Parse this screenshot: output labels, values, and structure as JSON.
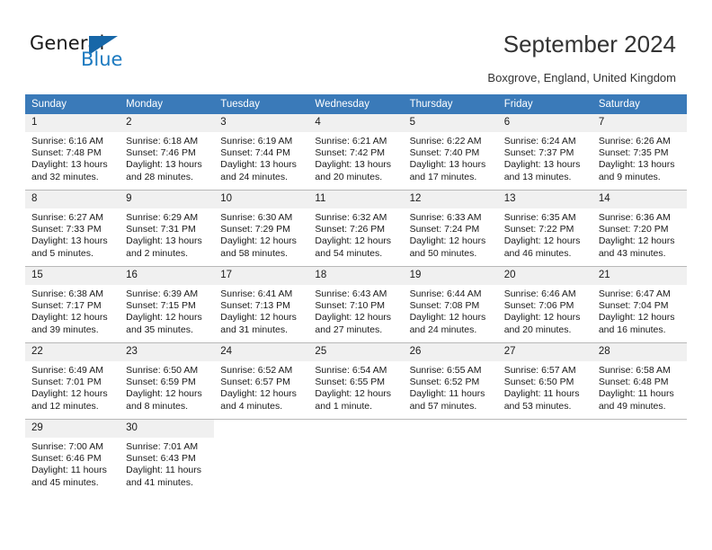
{
  "brand": {
    "name_part1": "General",
    "name_part2": "Blue"
  },
  "header": {
    "title": "September 2024",
    "location": "Boxgrove, England, United Kingdom"
  },
  "colors": {
    "header_bar": "#3a7ab9",
    "daynum_background": "#f0f0f0",
    "brand_blue": "#1c7ac0",
    "grid_line": "#b8b8b8"
  },
  "weekday_headers": [
    "Sunday",
    "Monday",
    "Tuesday",
    "Wednesday",
    "Thursday",
    "Friday",
    "Saturday"
  ],
  "weeks": [
    [
      {
        "day": "1",
        "sunrise": "Sunrise: 6:16 AM",
        "sunset": "Sunset: 7:48 PM",
        "daylight1": "Daylight: 13 hours",
        "daylight2": "and 32 minutes."
      },
      {
        "day": "2",
        "sunrise": "Sunrise: 6:18 AM",
        "sunset": "Sunset: 7:46 PM",
        "daylight1": "Daylight: 13 hours",
        "daylight2": "and 28 minutes."
      },
      {
        "day": "3",
        "sunrise": "Sunrise: 6:19 AM",
        "sunset": "Sunset: 7:44 PM",
        "daylight1": "Daylight: 13 hours",
        "daylight2": "and 24 minutes."
      },
      {
        "day": "4",
        "sunrise": "Sunrise: 6:21 AM",
        "sunset": "Sunset: 7:42 PM",
        "daylight1": "Daylight: 13 hours",
        "daylight2": "and 20 minutes."
      },
      {
        "day": "5",
        "sunrise": "Sunrise: 6:22 AM",
        "sunset": "Sunset: 7:40 PM",
        "daylight1": "Daylight: 13 hours",
        "daylight2": "and 17 minutes."
      },
      {
        "day": "6",
        "sunrise": "Sunrise: 6:24 AM",
        "sunset": "Sunset: 7:37 PM",
        "daylight1": "Daylight: 13 hours",
        "daylight2": "and 13 minutes."
      },
      {
        "day": "7",
        "sunrise": "Sunrise: 6:26 AM",
        "sunset": "Sunset: 7:35 PM",
        "daylight1": "Daylight: 13 hours",
        "daylight2": "and 9 minutes."
      }
    ],
    [
      {
        "day": "8",
        "sunrise": "Sunrise: 6:27 AM",
        "sunset": "Sunset: 7:33 PM",
        "daylight1": "Daylight: 13 hours",
        "daylight2": "and 5 minutes."
      },
      {
        "day": "9",
        "sunrise": "Sunrise: 6:29 AM",
        "sunset": "Sunset: 7:31 PM",
        "daylight1": "Daylight: 13 hours",
        "daylight2": "and 2 minutes."
      },
      {
        "day": "10",
        "sunrise": "Sunrise: 6:30 AM",
        "sunset": "Sunset: 7:29 PM",
        "daylight1": "Daylight: 12 hours",
        "daylight2": "and 58 minutes."
      },
      {
        "day": "11",
        "sunrise": "Sunrise: 6:32 AM",
        "sunset": "Sunset: 7:26 PM",
        "daylight1": "Daylight: 12 hours",
        "daylight2": "and 54 minutes."
      },
      {
        "day": "12",
        "sunrise": "Sunrise: 6:33 AM",
        "sunset": "Sunset: 7:24 PM",
        "daylight1": "Daylight: 12 hours",
        "daylight2": "and 50 minutes."
      },
      {
        "day": "13",
        "sunrise": "Sunrise: 6:35 AM",
        "sunset": "Sunset: 7:22 PM",
        "daylight1": "Daylight: 12 hours",
        "daylight2": "and 46 minutes."
      },
      {
        "day": "14",
        "sunrise": "Sunrise: 6:36 AM",
        "sunset": "Sunset: 7:20 PM",
        "daylight1": "Daylight: 12 hours",
        "daylight2": "and 43 minutes."
      }
    ],
    [
      {
        "day": "15",
        "sunrise": "Sunrise: 6:38 AM",
        "sunset": "Sunset: 7:17 PM",
        "daylight1": "Daylight: 12 hours",
        "daylight2": "and 39 minutes."
      },
      {
        "day": "16",
        "sunrise": "Sunrise: 6:39 AM",
        "sunset": "Sunset: 7:15 PM",
        "daylight1": "Daylight: 12 hours",
        "daylight2": "and 35 minutes."
      },
      {
        "day": "17",
        "sunrise": "Sunrise: 6:41 AM",
        "sunset": "Sunset: 7:13 PM",
        "daylight1": "Daylight: 12 hours",
        "daylight2": "and 31 minutes."
      },
      {
        "day": "18",
        "sunrise": "Sunrise: 6:43 AM",
        "sunset": "Sunset: 7:10 PM",
        "daylight1": "Daylight: 12 hours",
        "daylight2": "and 27 minutes."
      },
      {
        "day": "19",
        "sunrise": "Sunrise: 6:44 AM",
        "sunset": "Sunset: 7:08 PM",
        "daylight1": "Daylight: 12 hours",
        "daylight2": "and 24 minutes."
      },
      {
        "day": "20",
        "sunrise": "Sunrise: 6:46 AM",
        "sunset": "Sunset: 7:06 PM",
        "daylight1": "Daylight: 12 hours",
        "daylight2": "and 20 minutes."
      },
      {
        "day": "21",
        "sunrise": "Sunrise: 6:47 AM",
        "sunset": "Sunset: 7:04 PM",
        "daylight1": "Daylight: 12 hours",
        "daylight2": "and 16 minutes."
      }
    ],
    [
      {
        "day": "22",
        "sunrise": "Sunrise: 6:49 AM",
        "sunset": "Sunset: 7:01 PM",
        "daylight1": "Daylight: 12 hours",
        "daylight2": "and 12 minutes."
      },
      {
        "day": "23",
        "sunrise": "Sunrise: 6:50 AM",
        "sunset": "Sunset: 6:59 PM",
        "daylight1": "Daylight: 12 hours",
        "daylight2": "and 8 minutes."
      },
      {
        "day": "24",
        "sunrise": "Sunrise: 6:52 AM",
        "sunset": "Sunset: 6:57 PM",
        "daylight1": "Daylight: 12 hours",
        "daylight2": "and 4 minutes."
      },
      {
        "day": "25",
        "sunrise": "Sunrise: 6:54 AM",
        "sunset": "Sunset: 6:55 PM",
        "daylight1": "Daylight: 12 hours",
        "daylight2": "and 1 minute."
      },
      {
        "day": "26",
        "sunrise": "Sunrise: 6:55 AM",
        "sunset": "Sunset: 6:52 PM",
        "daylight1": "Daylight: 11 hours",
        "daylight2": "and 57 minutes."
      },
      {
        "day": "27",
        "sunrise": "Sunrise: 6:57 AM",
        "sunset": "Sunset: 6:50 PM",
        "daylight1": "Daylight: 11 hours",
        "daylight2": "and 53 minutes."
      },
      {
        "day": "28",
        "sunrise": "Sunrise: 6:58 AM",
        "sunset": "Sunset: 6:48 PM",
        "daylight1": "Daylight: 11 hours",
        "daylight2": "and 49 minutes."
      }
    ],
    [
      {
        "day": "29",
        "sunrise": "Sunrise: 7:00 AM",
        "sunset": "Sunset: 6:46 PM",
        "daylight1": "Daylight: 11 hours",
        "daylight2": "and 45 minutes."
      },
      {
        "day": "30",
        "sunrise": "Sunrise: 7:01 AM",
        "sunset": "Sunset: 6:43 PM",
        "daylight1": "Daylight: 11 hours",
        "daylight2": "and 41 minutes."
      },
      {
        "day": "",
        "sunrise": "",
        "sunset": "",
        "daylight1": "",
        "daylight2": ""
      },
      {
        "day": "",
        "sunrise": "",
        "sunset": "",
        "daylight1": "",
        "daylight2": ""
      },
      {
        "day": "",
        "sunrise": "",
        "sunset": "",
        "daylight1": "",
        "daylight2": ""
      },
      {
        "day": "",
        "sunrise": "",
        "sunset": "",
        "daylight1": "",
        "daylight2": ""
      },
      {
        "day": "",
        "sunrise": "",
        "sunset": "",
        "daylight1": "",
        "daylight2": ""
      }
    ]
  ]
}
